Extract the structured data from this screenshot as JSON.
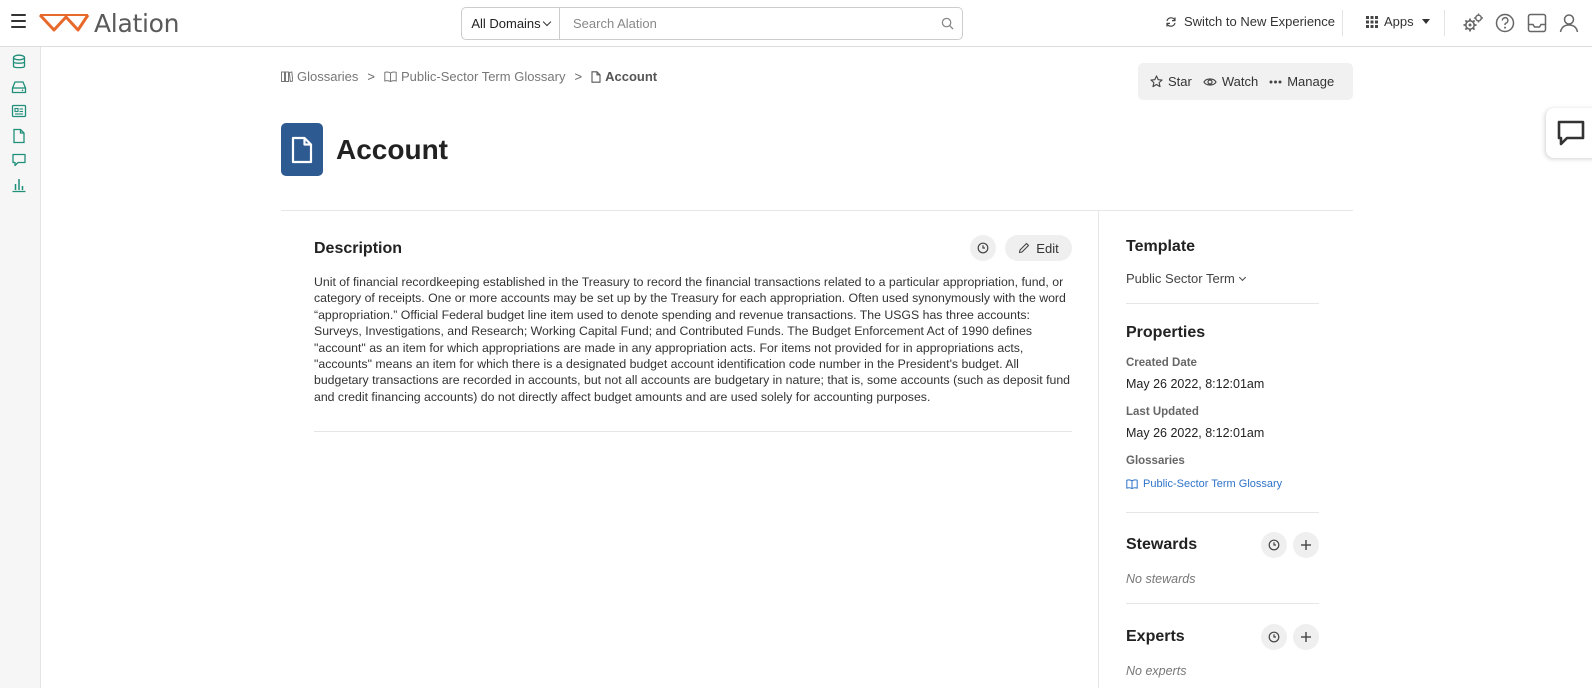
{
  "header": {
    "logo_text": "Alation",
    "domain_selector": "All Domains",
    "search_placeholder": "Search Alation",
    "switch_experience": "Switch to New Experience",
    "apps_label": "Apps"
  },
  "left_rail": {
    "icons": [
      "database-icon",
      "storage-icon",
      "catalog-card-icon",
      "document-icon",
      "conversation-icon",
      "chart-icon"
    ]
  },
  "breadcrumb": {
    "items": [
      "Glossaries",
      "Public-Sector Term Glossary",
      "Account"
    ],
    "separator": ">"
  },
  "page_actions": {
    "star": "Star",
    "watch": "Watch",
    "manage": "Manage"
  },
  "title": "Account",
  "description": {
    "heading": "Description",
    "edit_label": "Edit",
    "body": "Unit of financial recordkeeping established in the Treasury to record the financial transactions related to a particular appropriation, fund, or category of receipts. One or more accounts may be set up by the Treasury for each appropriation. Often used synonymously with the word “appropriation.” Official Federal budget line item used to denote spending and revenue transactions. The USGS has three accounts: Surveys, Investigations, and Research; Working Capital Fund; and Contributed Funds. The Budget Enforcement Act of 1990 defines \"account\" as an item for which appropriations are made in any appropriation acts. For items not provided for in appropriations acts, \"accounts\" means an item for which there is a designated budget account identification code number in the President's budget. All budgetary transactions are recorded in accounts, but not all accounts are budgetary in nature; that is, some accounts (such as deposit fund and credit financing accounts) do not directly affect budget amounts and are used solely for accounting purposes."
  },
  "sidebar": {
    "template_heading": "Template",
    "template_value": "Public Sector Term",
    "properties_heading": "Properties",
    "created_label": "Created Date",
    "created_value": "May 26 2022, 8:12:01am",
    "updated_label": "Last Updated",
    "updated_value": "May 26 2022, 8:12:01am",
    "glossaries_label": "Glossaries",
    "glossary_link": "Public-Sector Term Glossary",
    "stewards_heading": "Stewards",
    "stewards_empty": "No stewards",
    "experts_heading": "Experts",
    "experts_empty": "No experts"
  },
  "colors": {
    "brand_orange": "#e8692c",
    "title_icon_bg": "#2e5a92",
    "rail_icon": "#1f8f7a",
    "link_blue": "#2e73c8"
  }
}
